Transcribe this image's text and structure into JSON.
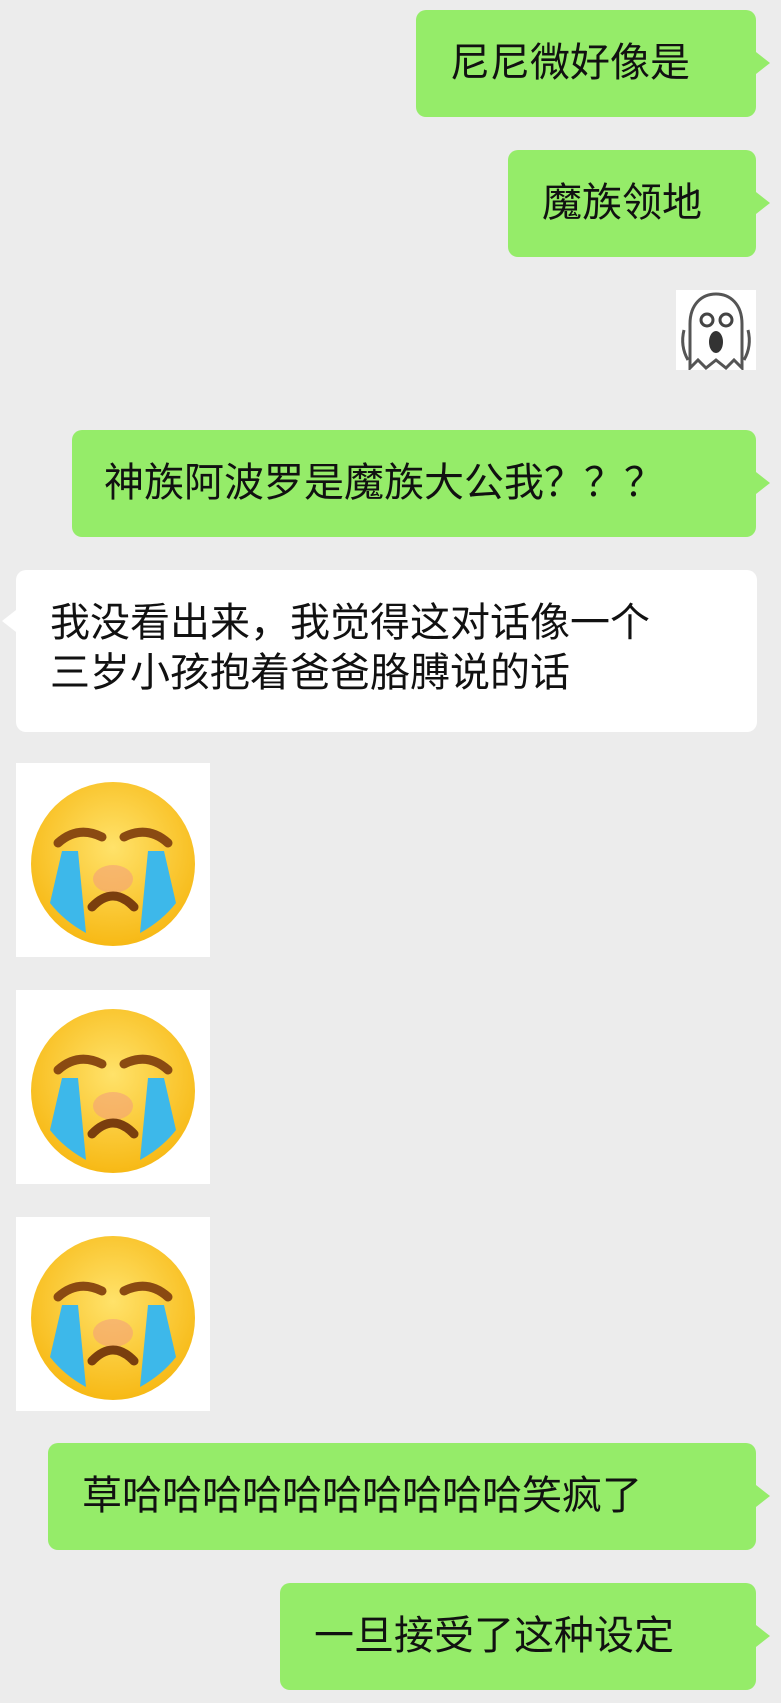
{
  "messages": [
    {
      "type": "text",
      "side": "right",
      "text": "尼尼微好像是"
    },
    {
      "type": "text",
      "side": "right",
      "text": "魔族领地"
    },
    {
      "type": "sticker",
      "side": "right",
      "icon": "screaming-ghost-icon"
    },
    {
      "type": "text",
      "side": "right",
      "text": "神族阿波罗是魔族大公我？？？"
    },
    {
      "type": "text",
      "side": "left",
      "lines": [
        "我没看出来，我觉得这对话像一个",
        "三岁小孩抱着爸爸胳膊说的话"
      ]
    },
    {
      "type": "sticker",
      "side": "left",
      "icon": "loudly-crying-face-icon"
    },
    {
      "type": "sticker",
      "side": "left",
      "icon": "loudly-crying-face-icon"
    },
    {
      "type": "sticker",
      "side": "left",
      "icon": "loudly-crying-face-icon"
    },
    {
      "type": "text",
      "side": "right",
      "text": "草哈哈哈哈哈哈哈哈哈哈笑疯了"
    },
    {
      "type": "text",
      "side": "right",
      "text": "一旦接受了这种设定"
    }
  ],
  "colors": {
    "background": "#ececec",
    "outgoing_bubble": "#95ec69",
    "incoming_bubble": "#ffffff",
    "text": "#111111"
  }
}
